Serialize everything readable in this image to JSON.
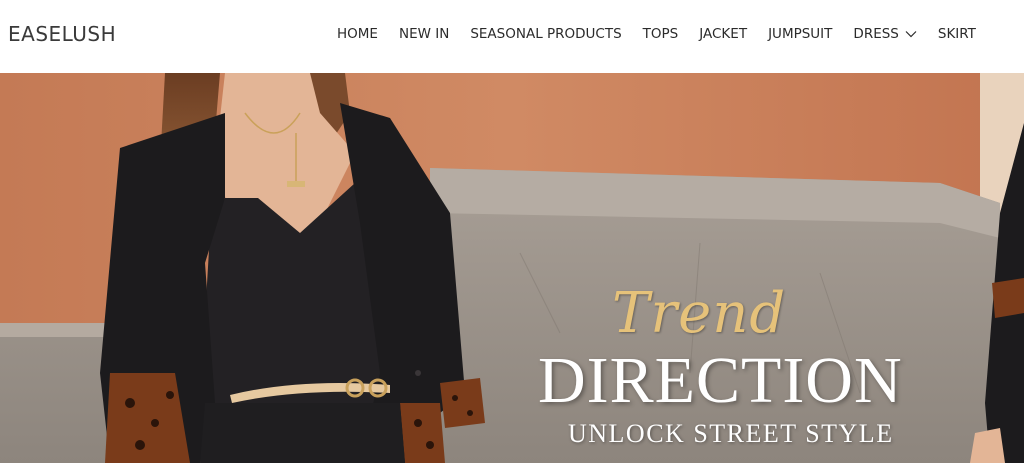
{
  "brand": {
    "logo_text": "EASELUSH"
  },
  "nav": {
    "items": [
      {
        "label": "HOME"
      },
      {
        "label": "NEW IN"
      },
      {
        "label": "SEASONAL PRODUCTS"
      },
      {
        "label": "TOPS"
      },
      {
        "label": "JACKET"
      },
      {
        "label": "JUMPSUIT"
      },
      {
        "label": "DRESS",
        "has_dropdown": true
      },
      {
        "label": "SKIRT"
      }
    ]
  },
  "hero": {
    "script_text": "Trend",
    "headline": "DIRECTION",
    "tagline": "UNLOCK STREET STYLE",
    "colors": {
      "script": "#e6c27a",
      "headline": "#ffffff",
      "wall": "#c9835f",
      "stone": "#9d9289"
    }
  }
}
